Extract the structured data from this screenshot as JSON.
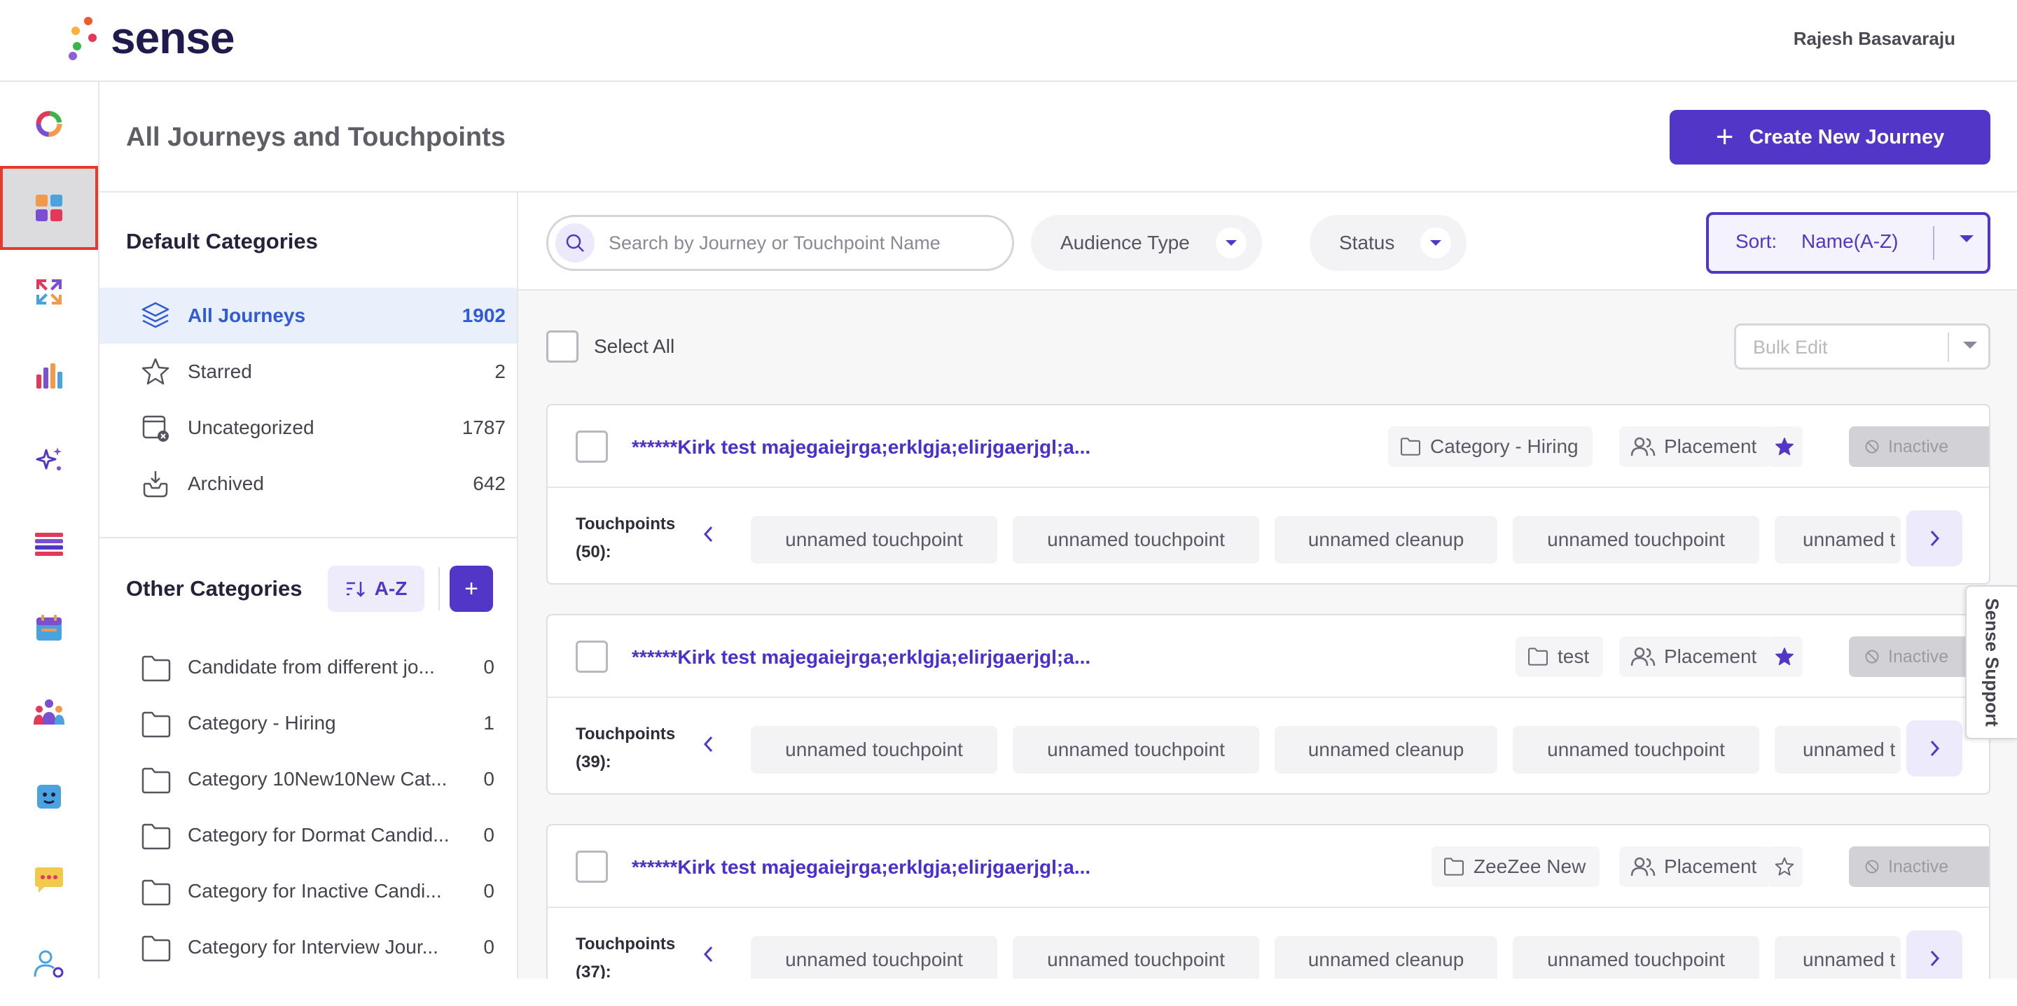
{
  "app": {
    "brand": "sense",
    "user": "Rajesh Basavaraju"
  },
  "rail": [
    {
      "name": "dashboard-icon"
    },
    {
      "name": "journeys-icon",
      "active": true
    },
    {
      "name": "workflows-icon"
    },
    {
      "name": "analytics-icon"
    },
    {
      "name": "ai-sparkle-icon"
    },
    {
      "name": "lists-icon"
    },
    {
      "name": "calendar-icon"
    },
    {
      "name": "people-icon"
    },
    {
      "name": "chatbot-icon"
    },
    {
      "name": "messages-icon"
    },
    {
      "name": "user-settings-icon"
    }
  ],
  "header": {
    "title": "All Journeys and Touchpoints",
    "create_label": "Create New Journey"
  },
  "categories": {
    "default_heading": "Default Categories",
    "default": [
      {
        "label": "All Journeys",
        "count": "1902",
        "icon": "layers-icon"
      },
      {
        "label": "Starred",
        "count": "2",
        "icon": "star-icon"
      },
      {
        "label": "Uncategorized",
        "count": "1787",
        "icon": "uncategorized-icon"
      },
      {
        "label": "Archived",
        "count": "642",
        "icon": "archive-icon"
      }
    ],
    "other_heading": "Other Categories",
    "sort_label": "A-Z",
    "add_label": "+",
    "other": [
      {
        "label": "Candidate from different jo...",
        "count": "0"
      },
      {
        "label": "Category - Hiring",
        "count": "1"
      },
      {
        "label": "Category 10New10New Cat...",
        "count": "0"
      },
      {
        "label": "Category for Dormat Candid...",
        "count": "0"
      },
      {
        "label": "Category for Inactive Candi...",
        "count": "0"
      },
      {
        "label": "Category for Interview Jour...",
        "count": "0"
      }
    ]
  },
  "filters": {
    "search_placeholder": "Search by Journey or Touchpoint Name",
    "audience_label": "Audience Type",
    "status_label": "Status",
    "sort_label": "Sort:",
    "sort_value": "Name(A-Z)",
    "select_all": "Select All",
    "bulk_edit": "Bulk Edit"
  },
  "journeys": [
    {
      "title": "******Kirk test majegaiejrga;erklgja;elirjgaerjgl;a...",
      "category": "Category - Hiring",
      "audience": "Placement",
      "starred": true,
      "status": "Inactive",
      "touchpoints_label": "Touchpoints",
      "touchpoints_count": "(50):",
      "chips": [
        "unnamed touchpoint",
        "unnamed touchpoint",
        "unnamed cleanup",
        "unnamed touchpoint",
        "unnamed t"
      ]
    },
    {
      "title": "******Kirk test majegaiejrga;erklgja;elirjgaerjgl;a...",
      "category": "test",
      "audience": "Placement",
      "starred": true,
      "status": "Inactive",
      "touchpoints_label": "Touchpoints",
      "touchpoints_count": "(39):",
      "chips": [
        "unnamed touchpoint",
        "unnamed touchpoint",
        "unnamed cleanup",
        "unnamed touchpoint",
        "unnamed t"
      ]
    },
    {
      "title": "******Kirk test majegaiejrga;erklgja;elirjgaerjgl;a...",
      "category": "ZeeZee New",
      "audience": "Placement",
      "starred": false,
      "status": "Inactive",
      "touchpoints_label": "Touchpoints",
      "touchpoints_count": "(37):",
      "chips": [
        "unnamed touchpoint",
        "unnamed touchpoint",
        "unnamed cleanup",
        "unnamed touchpoint",
        "unnamed t"
      ]
    }
  ],
  "support": {
    "label": "Sense Support"
  },
  "colors": {
    "accent": "#5236c7",
    "link": "#4b2fcf",
    "active_nav": "#2f5bd6",
    "highlight": "#e53b2c"
  }
}
